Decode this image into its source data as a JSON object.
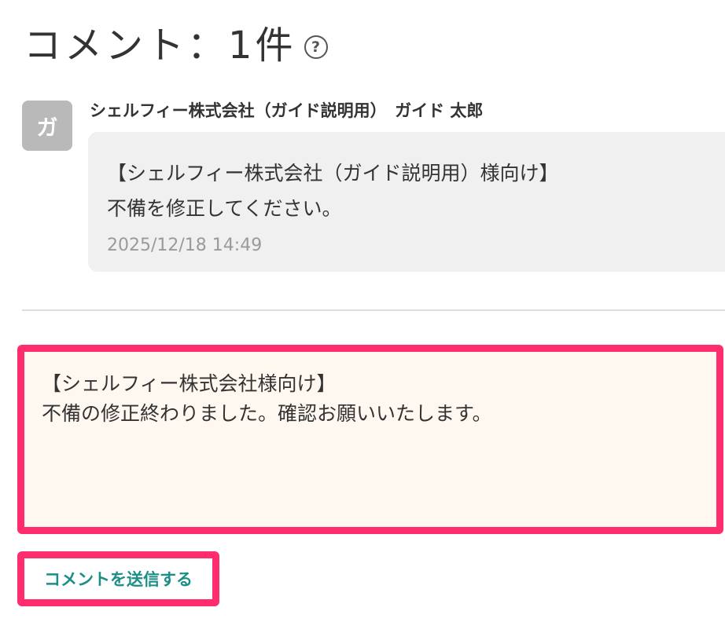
{
  "header": {
    "title": "コメント：1件",
    "help_icon": "question-circle-icon"
  },
  "comment": {
    "avatar_text": "ガ",
    "author": "シェルフィー株式会社（ガイド説明用）　ガイド 太郎",
    "lines": [
      "【シェルフィー株式会社（ガイド説明用）様向け】",
      "不備を修正してください。"
    ],
    "timestamp": "2025/12/18 14:49"
  },
  "reply": {
    "lines": [
      "【シェルフィー株式会社様向け】",
      "不備の修正終わりました。確認お願いいたします。"
    ],
    "submit_label": "コメントを送信する"
  },
  "colors": {
    "highlight": "#ff2d6e",
    "accent": "#1b8f86",
    "bubble": "#f0f0f0",
    "input_bg": "#fff8f1"
  }
}
